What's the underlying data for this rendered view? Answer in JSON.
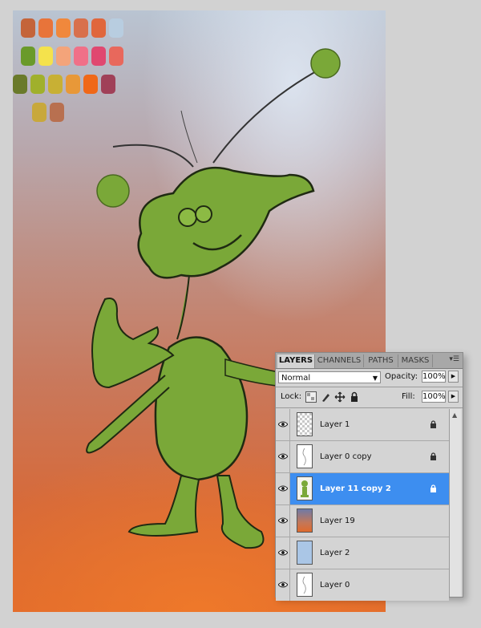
{
  "layers_panel": {
    "tabs": [
      {
        "label": "LAYERS",
        "active": true
      },
      {
        "label": "CHANNELS",
        "active": false
      },
      {
        "label": "PATHS",
        "active": false
      },
      {
        "label": "MASKS",
        "active": false
      }
    ],
    "menu_icon": "panel-menu-icon",
    "blend_mode": "Normal",
    "opacity_label": "Opacity:",
    "opacity_value": "100%",
    "lock_label": "Lock:",
    "lock_icons": [
      "lock-transparent-pixels-icon",
      "lock-image-pixels-icon",
      "lock-position-icon",
      "lock-all-icon"
    ],
    "fill_label": "Fill:",
    "fill_value": "100%",
    "layers": [
      {
        "name": "Layer 1",
        "thumb": "transparent",
        "locked": true,
        "selected": false
      },
      {
        "name": "Layer 0 copy",
        "thumb": "sketch",
        "locked": true,
        "selected": false
      },
      {
        "name": "Layer 11 copy 2",
        "thumb": "green-creature",
        "locked": true,
        "selected": true
      },
      {
        "name": "Layer 19",
        "thumb": "sunset",
        "locked": false,
        "selected": false
      },
      {
        "name": "Layer 2",
        "thumb": "blue",
        "locked": false,
        "selected": false
      },
      {
        "name": "Layer 0",
        "thumb": "sketch",
        "locked": false,
        "selected": false
      }
    ]
  },
  "palette_swatches": [
    "#c4643a",
    "#e8743a",
    "#f0883c",
    "#d8704c",
    "#e0663c",
    "#b8cde0",
    "#6a9a2a",
    "#f4e24c",
    "#f4a47a",
    "#f07088",
    "#e04870",
    "#e8685c",
    "#6a7a2a",
    "#a0b02c",
    "#c8b034",
    "#e89838",
    "#f06818",
    "#a04058",
    "#c8a83c",
    "#b87050"
  ],
  "colors": {
    "selection_blue": "#3d8ef0",
    "highlight_red": "#e01010",
    "creature_green": "#7aa838"
  }
}
